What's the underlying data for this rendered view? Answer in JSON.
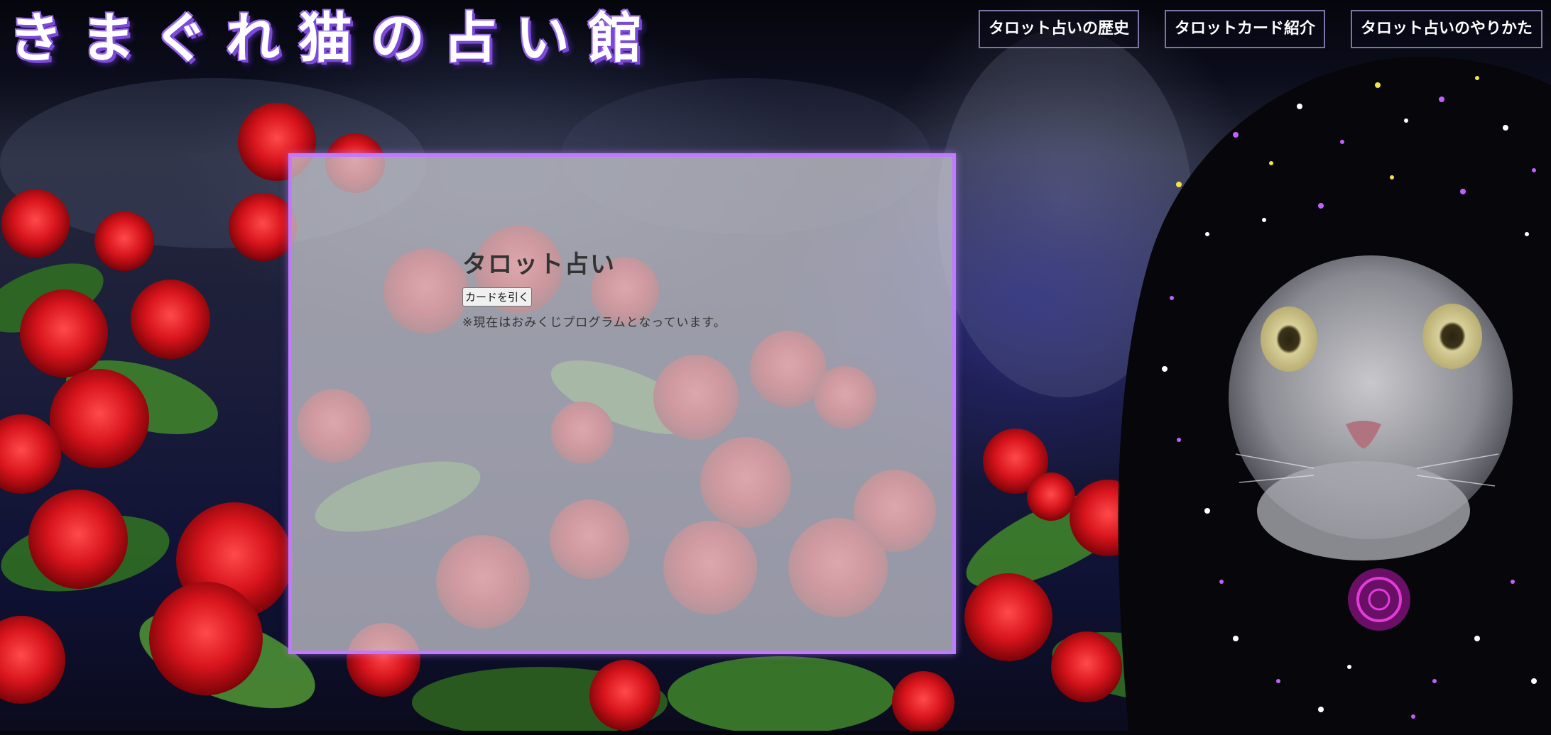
{
  "header": {
    "site_title": "きまぐれ猫の占い館",
    "nav": [
      {
        "label": "タロット占いの歴史"
      },
      {
        "label": "タロットカード紹介"
      },
      {
        "label": "タロット占いのやりかた"
      }
    ]
  },
  "main": {
    "title": "タロット占い",
    "draw_button_label": "カードを引く",
    "note": "※現在はおみくじプログラムとなっています。"
  },
  "colors": {
    "accent": "#c07aff",
    "title_shadow": "#7b4ad6",
    "nav_border": "#7b76a8",
    "rose": "#c8141e"
  },
  "background": {
    "description_icons": [
      "rose-bush-image",
      "fortune-teller-cat-image"
    ]
  }
}
